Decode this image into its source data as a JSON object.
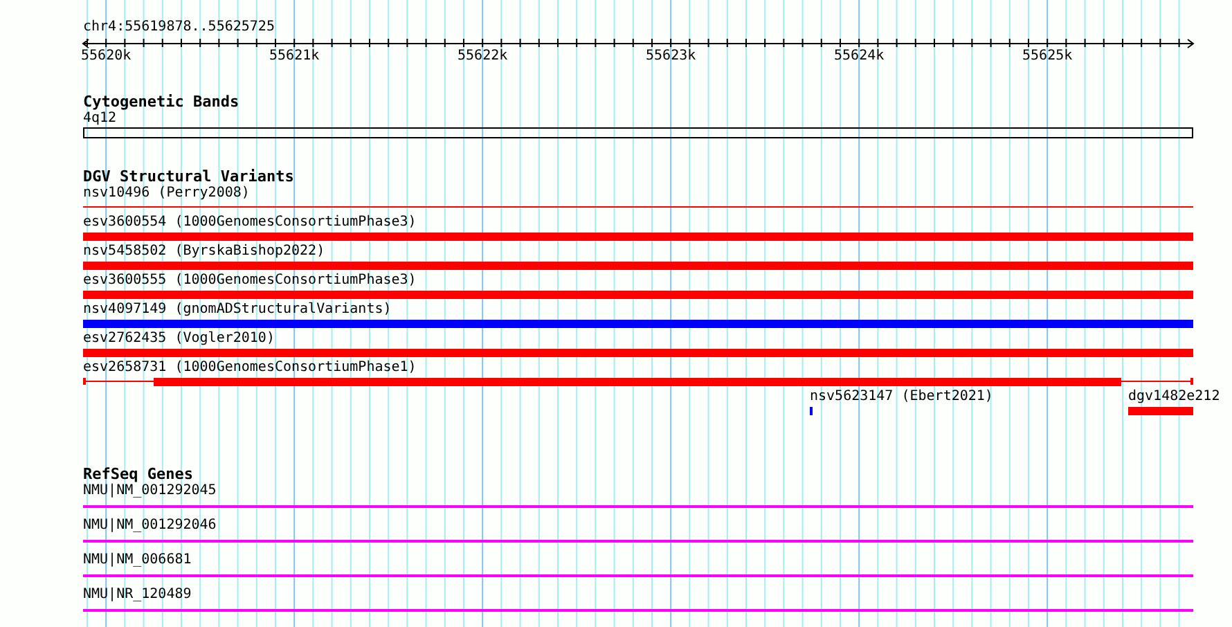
{
  "locus": "chr4:55619878..55625725",
  "ruler": {
    "ticks": [
      {
        "label": "55620k"
      },
      {
        "label": "55621k"
      },
      {
        "label": "55622k"
      },
      {
        "label": "55623k"
      },
      {
        "label": "55624k"
      },
      {
        "label": "55625k"
      }
    ]
  },
  "tracks": [
    {
      "title": "Cytogenetic Bands",
      "kind": "bands",
      "rows": [
        [
          {
            "label": "4q12",
            "kind": "band"
          }
        ]
      ]
    },
    {
      "title": "DGV Structural Variants",
      "kind": "variants",
      "rows": [
        [
          {
            "label": "nsv10496 (Perry2008)",
            "kind": "line",
            "color": "#ff0000"
          }
        ],
        [
          {
            "label": "esv3600554 (1000GenomesConsortiumPhase3)",
            "kind": "bar",
            "color": "#ff0000"
          }
        ],
        [
          {
            "label": "nsv5458502 (ByrskaBishop2022)",
            "kind": "bar",
            "color": "#ff0000"
          }
        ],
        [
          {
            "label": "esv3600555 (1000GenomesConsortiumPhase3)",
            "kind": "bar",
            "color": "#ff0000"
          }
        ],
        [
          {
            "label": "nsv4097149 (gnomADStructuralVariants)",
            "kind": "bar",
            "color": "#0000ff"
          }
        ],
        [
          {
            "label": "esv2762435 (Vogler2010)",
            "kind": "bar",
            "color": "#ff0000"
          }
        ],
        [
          {
            "label": "esv2658731 (1000GenomesConsortiumPhase1)",
            "kind": "gapped",
            "color": "#ff0000"
          }
        ],
        [
          {
            "label": "nsv5623147 (Ebert2021)",
            "kind": "bar",
            "color": "#0000ff"
          },
          {
            "label": "dgv1482e212",
            "kind": "bar",
            "color": "#ff0000"
          }
        ]
      ]
    },
    {
      "title": "RefSeq Genes",
      "kind": "genes",
      "rows": [
        [
          {
            "label": "NMU|NM_001292045",
            "kind": "gene"
          }
        ],
        [
          {
            "label": "NMU|NM_001292046",
            "kind": "gene"
          }
        ],
        [
          {
            "label": "NMU|NM_006681",
            "kind": "gene"
          }
        ],
        [
          {
            "label": "NMU|NR_120489",
            "kind": "gene"
          }
        ]
      ]
    }
  ]
}
